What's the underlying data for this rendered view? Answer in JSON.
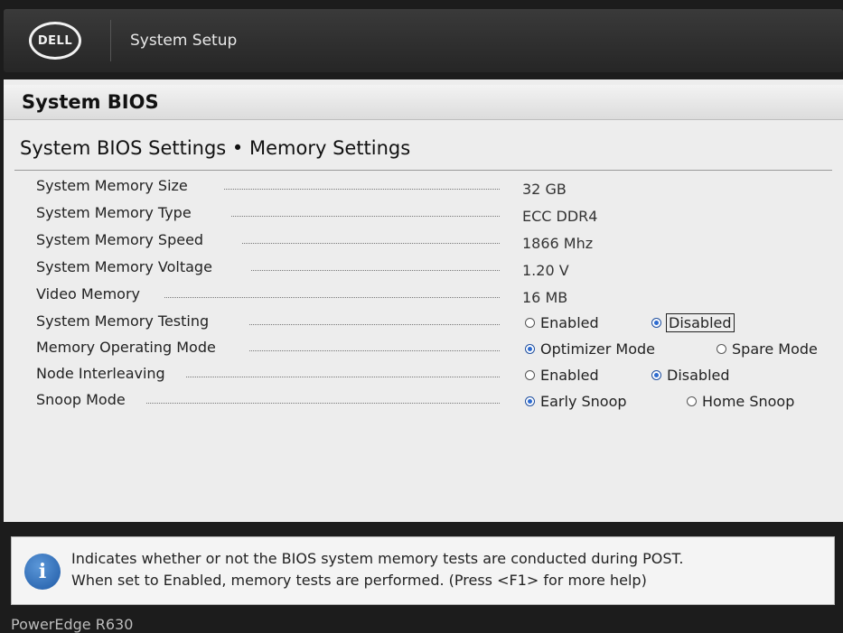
{
  "header": {
    "logo_text": "DELL",
    "title": "System Setup"
  },
  "page": {
    "bios_title": "System BIOS",
    "section_title": "System BIOS Settings • Memory Settings"
  },
  "settings": [
    {
      "label": "System Memory Size",
      "value": "32 GB"
    },
    {
      "label": "System Memory Type",
      "value": "ECC DDR4"
    },
    {
      "label": "System Memory Speed",
      "value": "1866 Mhz"
    },
    {
      "label": "System Memory Voltage",
      "value": "1.20 V"
    },
    {
      "label": "Video Memory",
      "value": "16 MB"
    },
    {
      "label": "System Memory Testing",
      "options": [
        "Enabled",
        "Disabled"
      ],
      "selected": "Disabled"
    },
    {
      "label": "Memory Operating Mode",
      "options": [
        "Optimizer Mode",
        "Spare Mode"
      ],
      "selected": "Optimizer Mode"
    },
    {
      "label": "Node Interleaving",
      "options": [
        "Enabled",
        "Disabled"
      ],
      "selected": "Disabled"
    },
    {
      "label": "Snoop Mode",
      "options": [
        "Early Snoop",
        "Home Snoop"
      ],
      "selected": "Early Snoop"
    }
  ],
  "help": {
    "icon": "info-icon",
    "line1": "Indicates whether or not the BIOS system memory tests are conducted during POST.",
    "line2": "When set to Enabled, memory tests are performed. (Press <F1> for more help)"
  },
  "footer": {
    "model": "PowerEdge R630"
  }
}
